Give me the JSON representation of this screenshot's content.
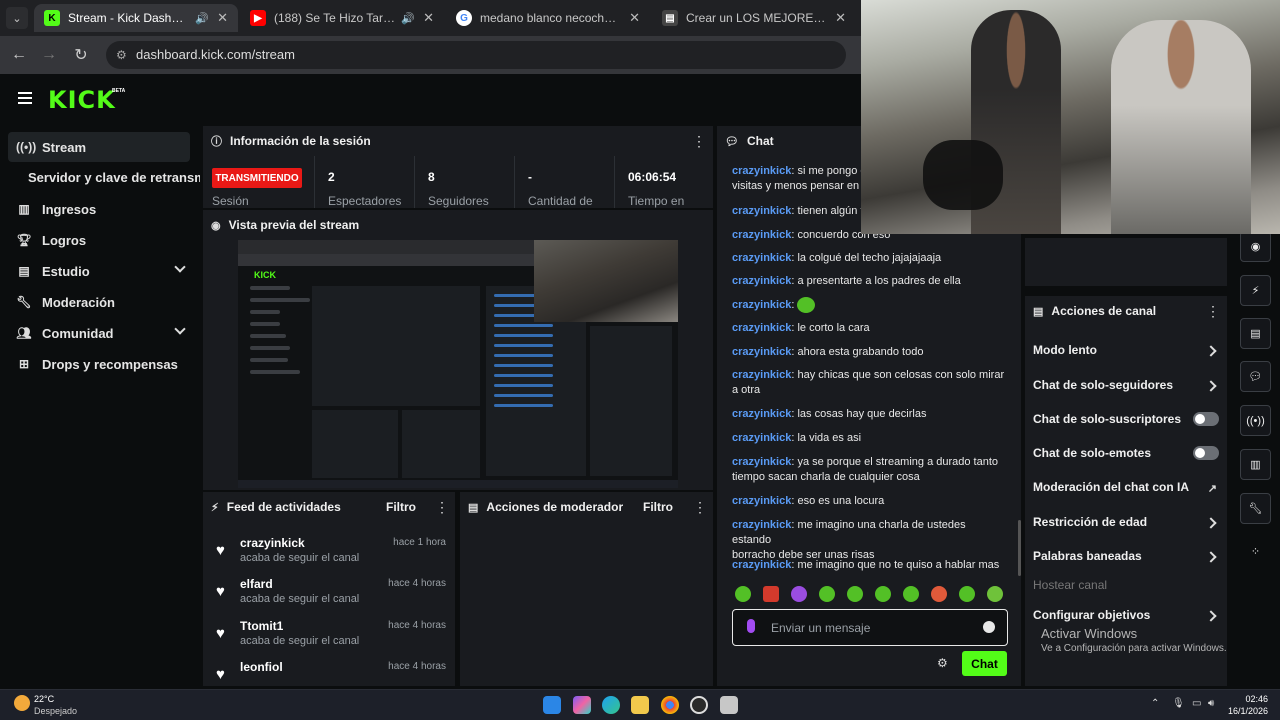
{
  "browser": {
    "tabs": [
      {
        "label": "Stream - Kick Dashboard",
        "active": true
      },
      {
        "label": "(188) Se Te Hizo Tarde (feat",
        "active": false
      },
      {
        "label": "medano blanco necochea - Bus",
        "active": false
      },
      {
        "label": "Crear un LOS MEJORES ALFAJO",
        "active": false
      }
    ],
    "url": "dashboard.kick.com/stream"
  },
  "brand": {
    "logo": "KICK",
    "beta": "BETA",
    "accent": "#53fc18"
  },
  "sidebar": {
    "items": [
      {
        "label": "Stream",
        "icon": "broadcast-icon"
      },
      {
        "label": "Ingresos",
        "icon": "bar-chart-icon"
      },
      {
        "label": "Logros",
        "icon": "trophy-icon"
      },
      {
        "label": "Estudio",
        "icon": "layout-icon"
      },
      {
        "label": "Moderación",
        "icon": "wrench-icon"
      },
      {
        "label": "Comunidad",
        "icon": "users-icon"
      },
      {
        "label": "Drops y recompensas",
        "icon": "gift-icon"
      }
    ],
    "sub_item": "Servidor y clave de retransm"
  },
  "session": {
    "title": "Información de la sesión",
    "status": "TRANSMITIENDO",
    "status_label": "Sesión",
    "stats": [
      {
        "value": "2",
        "label": "Espectadores"
      },
      {
        "value": "8",
        "label": "Seguidores"
      },
      {
        "value": "-",
        "label": "Cantidad de"
      },
      {
        "value": "06:06:54",
        "label": "Tiempo en"
      }
    ]
  },
  "preview": {
    "title": "Vista previa del stream"
  },
  "feed": {
    "title": "Feed de actividades",
    "filter": "Filtro",
    "items": [
      {
        "name": "crazyinkick",
        "action": "acaba de seguir el canal",
        "time": "hace 1 hora"
      },
      {
        "name": "elfard",
        "action": "acaba de seguir el canal",
        "time": "hace 4 horas"
      },
      {
        "name": "Ttomit1",
        "action": "acaba de seguir el canal",
        "time": "hace 4 horas"
      },
      {
        "name": "leonfiol",
        "action": "",
        "time": "hace 4 horas"
      }
    ]
  },
  "mod_actions": {
    "title": "Acciones de moderador",
    "filter": "Filtro"
  },
  "chat": {
    "title": "Chat",
    "messages": [
      {
        "user": "crazyinkick",
        "text": "si me pongo e",
        "text2": "visitas y menos pensar en g"
      },
      {
        "user": "crazyinkick",
        "text": "tienen algún fo"
      },
      {
        "user": "crazyinkick",
        "text": "concuerdo con eso"
      },
      {
        "user": "crazyinkick",
        "text": "la colgué del techo jajajajaaja"
      },
      {
        "user": "crazyinkick",
        "text": "a presentarte a los padres de ella"
      },
      {
        "user": "crazyinkick",
        "text": ""
      },
      {
        "user": "crazyinkick",
        "text": "le corto la cara"
      },
      {
        "user": "crazyinkick",
        "text": "ahora esta grabando todo"
      },
      {
        "user": "crazyinkick",
        "text": "hay chicas que son celosas con solo mirar",
        "text2": "a otra"
      },
      {
        "user": "crazyinkick",
        "text": "las cosas hay que decirlas"
      },
      {
        "user": "crazyinkick",
        "text": "la vida es asi"
      },
      {
        "user": "crazyinkick",
        "text": "ya se porque el streaming a durado tanto",
        "text2": "tiempo sacan charla de cualquier cosa"
      },
      {
        "user": "crazyinkick",
        "text": "eso es una locura"
      },
      {
        "user": "crazyinkick",
        "text": "me imagino una charla de ustedes estando",
        "text2": "borracho debe ser unas risas"
      },
      {
        "user": "crazyinkick",
        "text": "me imagino que no te quiso a hablar mas"
      }
    ],
    "input_placeholder": "Enviar un mensaje",
    "send_label": "Chat"
  },
  "channel_actions": {
    "title": "Acciones de canal",
    "items": [
      {
        "label": "Modo lento",
        "kind": "chevron"
      },
      {
        "label": "Chat de solo-seguidores",
        "kind": "chevron"
      },
      {
        "label": "Chat de solo-suscriptores",
        "kind": "toggle"
      },
      {
        "label": "Chat de solo-emotes",
        "kind": "toggle"
      },
      {
        "label": "Moderación del chat con IA",
        "kind": "external"
      },
      {
        "label": "Restricción de edad",
        "kind": "chevron"
      },
      {
        "label": "Palabras baneadas",
        "kind": "chevron"
      },
      {
        "label": "Hostear canal",
        "kind": "disabled"
      },
      {
        "label": "Configurar objetivos",
        "kind": "chevron"
      }
    ]
  },
  "windows": {
    "activate_title": "Activar Windows",
    "activate_sub": "Ve a Configuración para activar Windows.",
    "weather_temp": "22°C",
    "weather_cond": "Despejado",
    "time": "02:46",
    "date": "16/1/2026"
  }
}
